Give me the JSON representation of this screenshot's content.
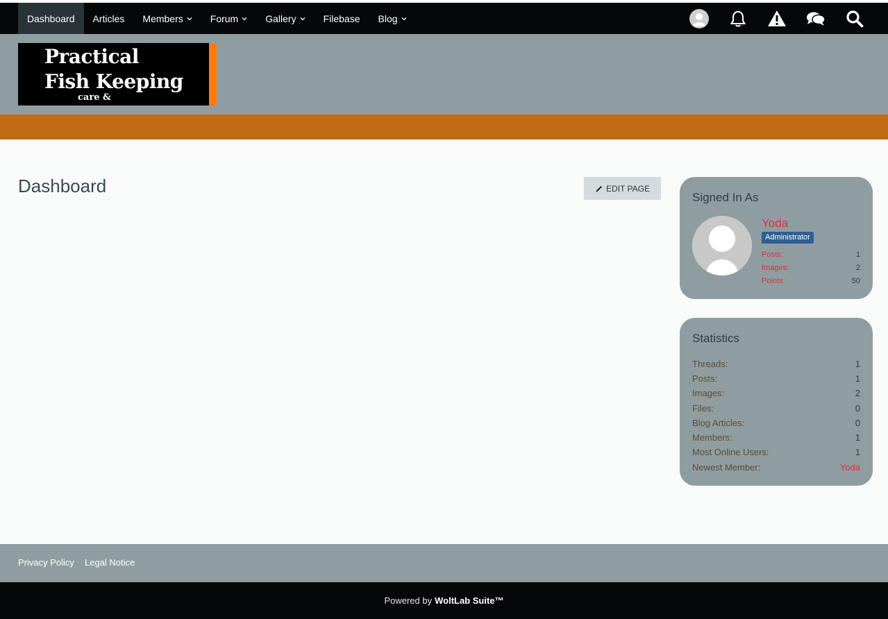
{
  "nav": {
    "items": [
      {
        "label": "Dashboard",
        "has_menu": false,
        "active": true
      },
      {
        "label": "Articles",
        "has_menu": false,
        "active": false
      },
      {
        "label": "Members",
        "has_menu": true,
        "active": false
      },
      {
        "label": "Forum",
        "has_menu": true,
        "active": false
      },
      {
        "label": "Gallery",
        "has_menu": true,
        "active": false
      },
      {
        "label": "Filebase",
        "has_menu": false,
        "active": false
      },
      {
        "label": "Blog",
        "has_menu": true,
        "active": false
      }
    ],
    "icons": [
      "user-avatar-icon",
      "bell-icon",
      "warning-icon",
      "conversations-icon",
      "search-icon"
    ]
  },
  "logo": {
    "line1": "Practical",
    "line2": "Fish  Keeping",
    "line3": "care &"
  },
  "main": {
    "title": "Dashboard",
    "edit_button": "Edit Page"
  },
  "signed_in": {
    "title": "Signed In As",
    "username": "Yoda",
    "role": "Administrator",
    "stats": [
      {
        "label": "Posts:",
        "value": "1"
      },
      {
        "label": "Images:",
        "value": "2"
      },
      {
        "label": "Points:",
        "value": "50"
      }
    ]
  },
  "statistics": {
    "title": "Statistics",
    "rows": [
      {
        "label": "Threads:",
        "value": "1"
      },
      {
        "label": "Posts:",
        "value": "1"
      },
      {
        "label": "Images:",
        "value": "2"
      },
      {
        "label": "Files:",
        "value": "0"
      },
      {
        "label": "Blog Articles:",
        "value": "0"
      },
      {
        "label": "Members:",
        "value": "1"
      },
      {
        "label": "Most Online Users:",
        "value": "1"
      },
      {
        "label": "Newest Member:",
        "value": "Yoda"
      }
    ]
  },
  "footer": {
    "privacy": "Privacy Policy",
    "legal": "Legal Notice",
    "powered_prefix": "Powered by",
    "powered_brand": "WoltLab Suite™"
  },
  "colors": {
    "nav_bg": "#050708",
    "header_bg": "#8f9da0",
    "accent_orange": "#c26b15",
    "link_red": "#dc2f42",
    "badge_blue": "#2d5f93"
  }
}
